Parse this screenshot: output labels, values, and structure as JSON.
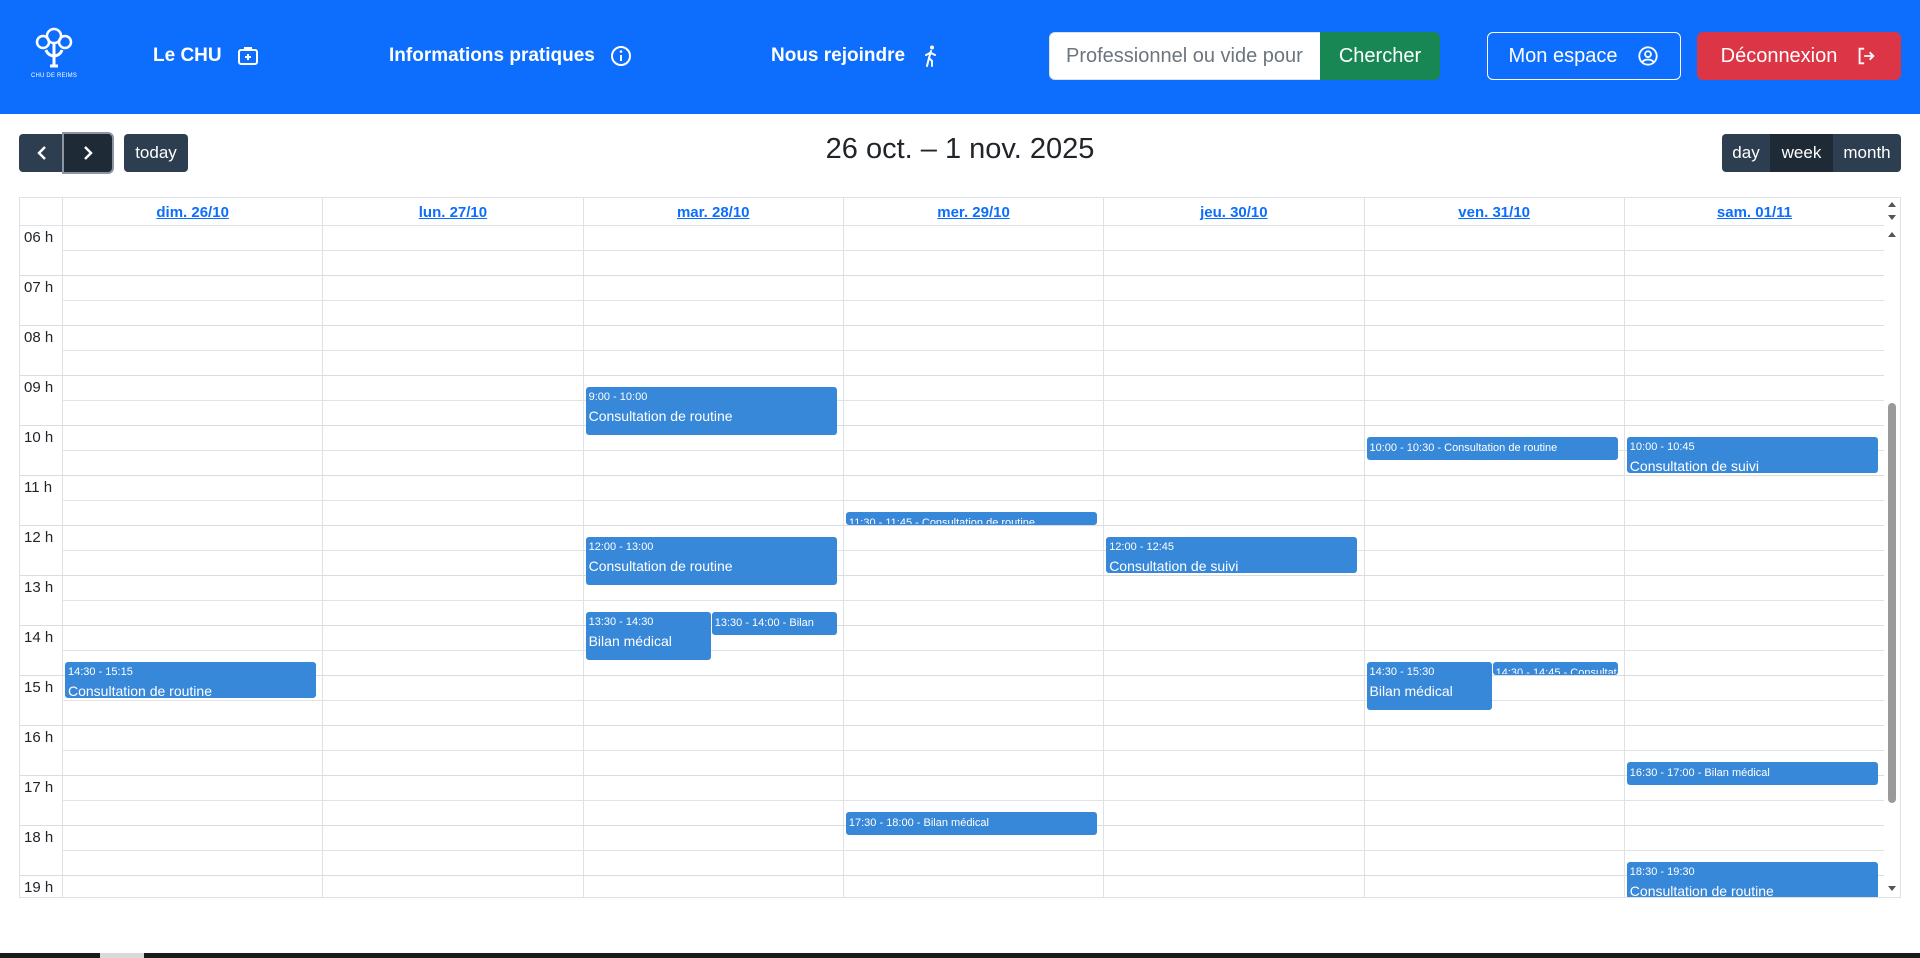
{
  "header": {
    "logo_text": "CHU DE REIMS",
    "nav": [
      {
        "label": "Le CHU",
        "icon": "medical-kit-icon"
      },
      {
        "label": "Informations pratiques",
        "icon": "info-icon"
      },
      {
        "label": "Nous rejoindre",
        "icon": "person-walking-icon"
      }
    ],
    "search_placeholder": "Professionnel ou vide pour tout",
    "search_button": "Chercher",
    "account_button": "Mon espace",
    "logout_button": "Déconnexion",
    "colors": {
      "brand": "#0d6efd",
      "search": "#198754",
      "logout": "#dc3545"
    }
  },
  "calendar": {
    "title": "26 oct. – 1 nov. 2025",
    "today_label": "today",
    "views": [
      "day",
      "week",
      "month"
    ],
    "active_view": "week",
    "days": [
      "dim. 26/10",
      "lun. 27/10",
      "mar. 28/10",
      "mer. 29/10",
      "jeu. 30/10",
      "ven. 31/10",
      "sam. 01/11"
    ],
    "hours": [
      "06 h",
      "07 h",
      "08 h",
      "09 h",
      "10 h",
      "11 h",
      "12 h",
      "13 h",
      "14 h",
      "15 h",
      "16 h",
      "17 h",
      "18 h",
      "19 h"
    ],
    "event_color": "#3788d8",
    "events": [
      {
        "day": 2,
        "start": "09:00",
        "end": "10:00",
        "time": "9:00 - 10:00",
        "title": "Consultation de routine",
        "stacked": true
      },
      {
        "day": 2,
        "start": "12:00",
        "end": "13:00",
        "time": "12:00 - 13:00",
        "title": "Consultation de routine",
        "stacked": true
      },
      {
        "day": 2,
        "start": "13:30",
        "end": "14:30",
        "time": "13:30 - 14:30",
        "title": "Bilan médical",
        "stacked": true,
        "sub": 0,
        "subs": 2
      },
      {
        "day": 2,
        "start": "13:30",
        "end": "14:00",
        "time": "13:30 - 14:00",
        "title": "Bilan",
        "stacked": false,
        "sub": 1,
        "subs": 2
      },
      {
        "day": 0,
        "start": "14:30",
        "end": "15:15",
        "time": "14:30 - 15:15",
        "title": "Consultation de routine",
        "stacked": true
      },
      {
        "day": 3,
        "start": "11:30",
        "end": "11:45",
        "time": "11:30 - 11:45",
        "title": "Consultation de routine",
        "stacked": false
      },
      {
        "day": 3,
        "start": "17:30",
        "end": "18:00",
        "time": "17:30 - 18:00",
        "title": "Bilan médical",
        "stacked": false
      },
      {
        "day": 4,
        "start": "12:00",
        "end": "12:45",
        "time": "12:00 - 12:45",
        "title": "Consultation de suivi",
        "stacked": true
      },
      {
        "day": 5,
        "start": "10:00",
        "end": "10:30",
        "time": "10:00 - 10:30",
        "title": "Consultation de routine",
        "stacked": false
      },
      {
        "day": 5,
        "start": "14:30",
        "end": "15:30",
        "time": "14:30 - 15:30",
        "title": "Bilan médical",
        "stacked": true,
        "sub": 0,
        "subs": 2
      },
      {
        "day": 5,
        "start": "14:30",
        "end": "14:45",
        "time": "14:30 - 14:45",
        "title": "Consultation de routine",
        "stacked": false,
        "sub": 1,
        "subs": 2
      },
      {
        "day": 6,
        "start": "10:00",
        "end": "10:45",
        "time": "10:00 - 10:45",
        "title": "Consultation de suivi",
        "stacked": true
      },
      {
        "day": 6,
        "start": "16:30",
        "end": "17:00",
        "time": "16:30 - 17:00",
        "title": "Bilan médical",
        "stacked": false
      },
      {
        "day": 6,
        "start": "18:30",
        "end": "19:30",
        "time": "18:30 - 19:30",
        "title": "Consultation de routine",
        "stacked": true
      }
    ]
  }
}
